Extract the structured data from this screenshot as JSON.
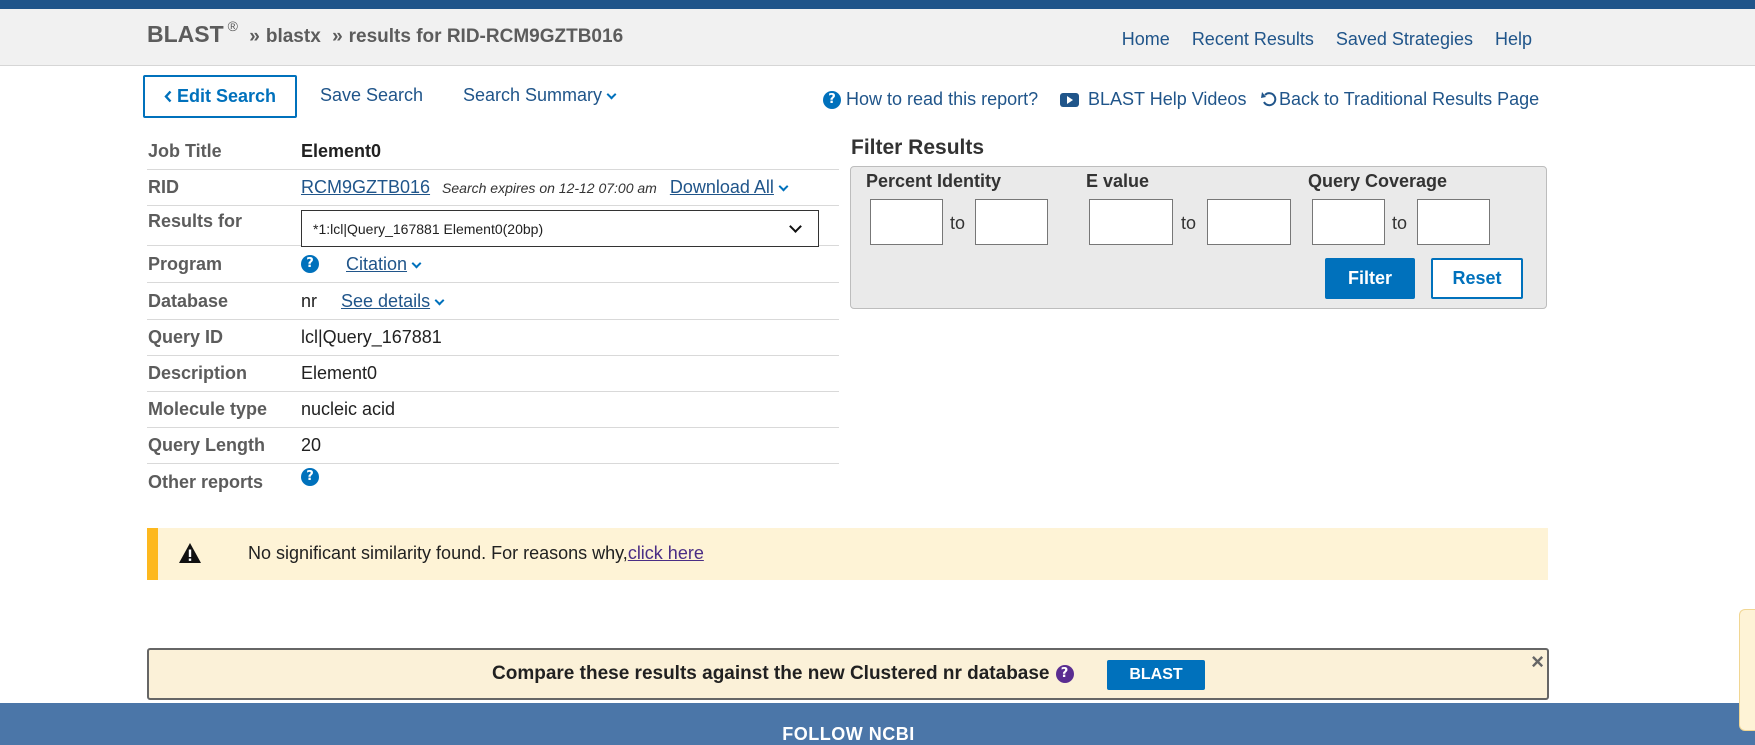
{
  "header": {
    "brand": "BLAST",
    "reg": "®",
    "crumb_sep": "»",
    "program": "blastx",
    "results_title": "results for RID-RCM9GZTB016",
    "nav": [
      "Home",
      "Recent Results",
      "Saved Strategies",
      "Help"
    ]
  },
  "toolbar": {
    "edit_search": "Edit Search",
    "save_search": "Save Search",
    "search_summary": "Search Summary",
    "how_to_read": "How to read this report?",
    "help_videos": "BLAST Help Videos",
    "back_traditional": "Back to Traditional Results Page"
  },
  "summary": {
    "job_title_label": "Job Title",
    "job_title": "Element0",
    "rid_label": "RID",
    "rid": "RCM9GZTB016",
    "expires": "Search expires on 12-12 07:00 am",
    "download_all": "Download All",
    "results_for_label": "Results for",
    "results_for_value": "*1:lcl|Query_167881 Element0(20bp)",
    "program_label": "Program",
    "citation": "Citation",
    "database_label": "Database",
    "database": "nr",
    "see_details": "See details",
    "query_id_label": "Query ID",
    "query_id": "lcl|Query_167881",
    "description_label": "Description",
    "description": "Element0",
    "molecule_type_label": "Molecule type",
    "molecule_type": "nucleic acid",
    "query_length_label": "Query Length",
    "query_length": "20",
    "other_reports_label": "Other reports"
  },
  "filter": {
    "title": "Filter Results",
    "percent_identity": "Percent Identity",
    "e_value": "E value",
    "query_coverage": "Query Coverage",
    "to": "to",
    "filter_button": "Filter",
    "reset_button": "Reset"
  },
  "warning": {
    "text": "No significant similarity found. For reasons why,",
    "link": "click here"
  },
  "cluster_banner": {
    "text": "Compare these results against the new Clustered nr database",
    "button": "BLAST",
    "close": "×"
  },
  "footer": {
    "title": "FOLLOW NCBI"
  },
  "colors": {
    "brand_blue": "#20558a",
    "action_blue": "#0071bc",
    "warning_bg": "#fef3d6",
    "warning_bar": "#fdb81e",
    "footer_bg": "#4b76a8"
  },
  "icons": [
    "chevron-left-icon",
    "chevron-down-icon",
    "help-circle-icon",
    "youtube-icon",
    "undo-icon",
    "warning-triangle-icon",
    "close-icon"
  ]
}
